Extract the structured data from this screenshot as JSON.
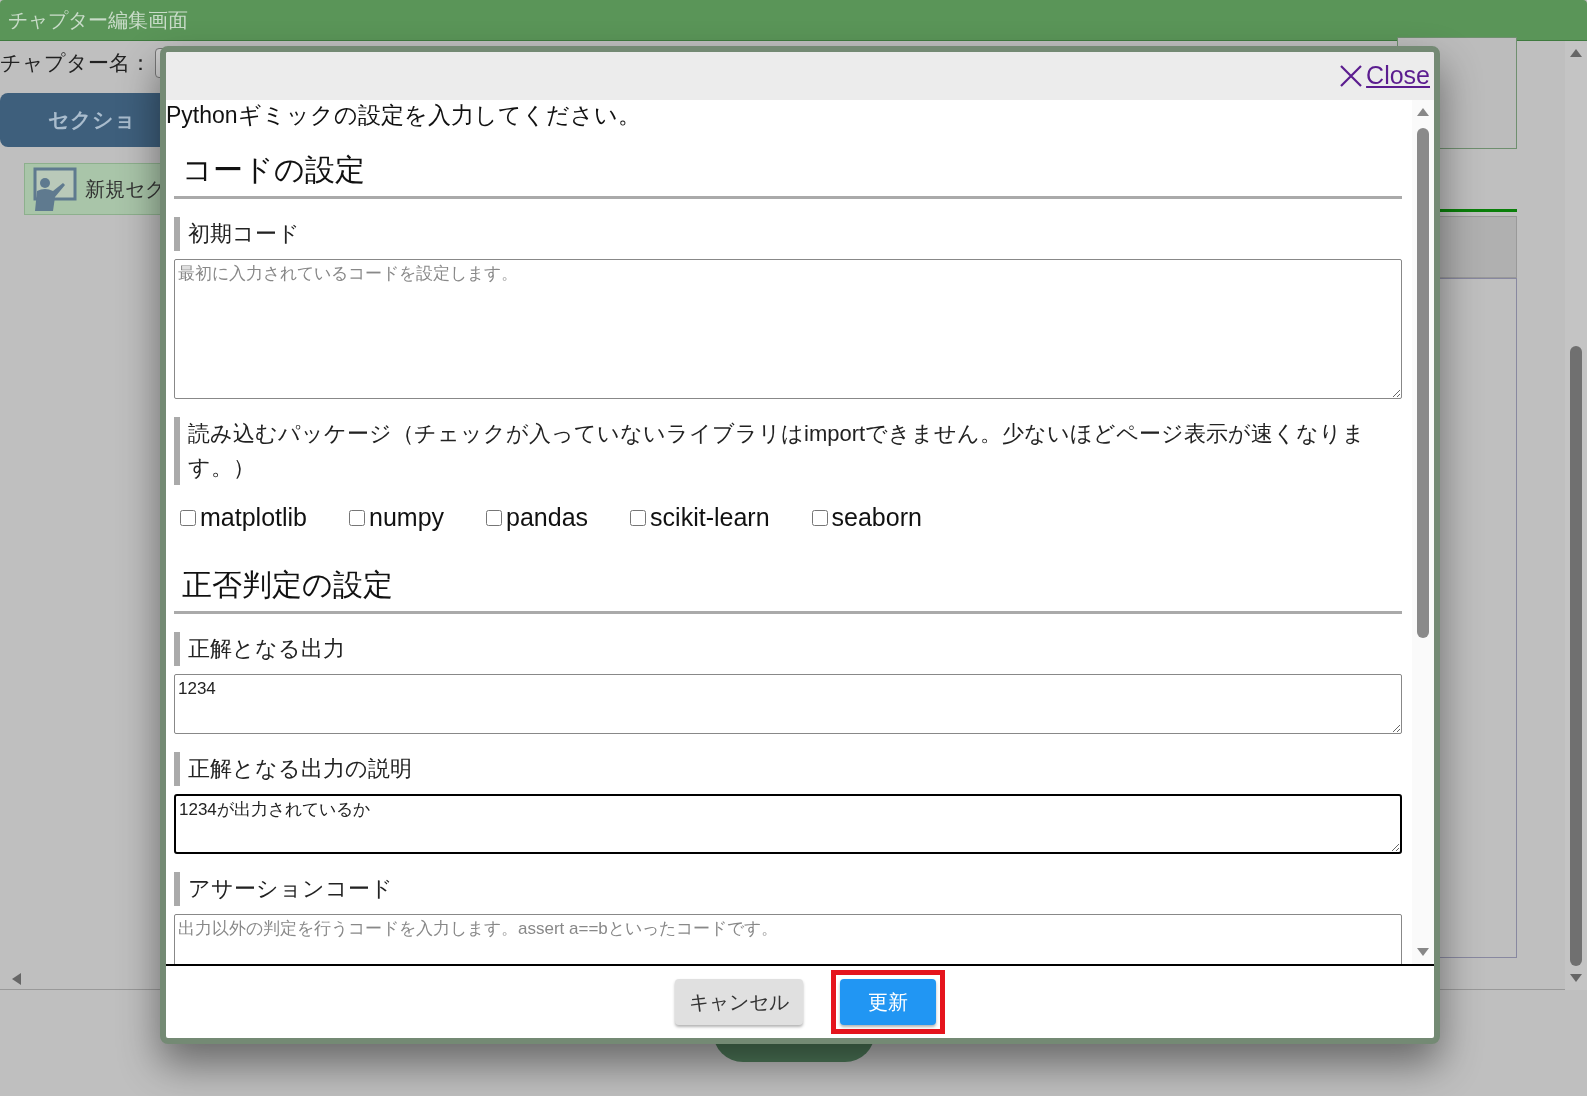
{
  "page": {
    "title": "チャプター編集画面",
    "chapter_name_label": "チャプター名：",
    "section_button": "セクショ",
    "section_item": "新規セク"
  },
  "dialog": {
    "close_label": "Close",
    "intro": "Pythonギミックの設定を入力してください。",
    "sections": [
      {
        "heading": "コードの設定",
        "items": [
          {
            "kind": "code",
            "label": "初期コード",
            "placeholder": "最初に入力されているコードを設定します。",
            "focused": false
          },
          {
            "kind": "checkboxes",
            "label": "読み込むパッケージ（チェックが入っていないライブラリはimportできません。少ないほどページ表示が速くなります。）",
            "options": [
              {
                "label": "matplotlib",
                "checked": false
              },
              {
                "label": "numpy",
                "checked": false
              },
              {
                "label": "pandas",
                "checked": false
              },
              {
                "label": "scikit-learn",
                "checked": false
              },
              {
                "label": "seaborn",
                "checked": false
              }
            ]
          }
        ]
      },
      {
        "heading": "正否判定の設定",
        "items": [
          {
            "kind": "line",
            "label": "正解となる出力",
            "value": "1234",
            "focused": false
          },
          {
            "kind": "line",
            "label": "正解となる出力の説明",
            "value": "1234が出力されているか",
            "focused": true
          },
          {
            "kind": "code",
            "label": "アサーションコード",
            "placeholder": "出力以外の判定を行うコードを入力します。assert a==bといったコードです。",
            "focused": false
          }
        ]
      }
    ],
    "buttons": [
      {
        "label": "キャンセル",
        "kind": "secondary",
        "highlighted": false
      },
      {
        "label": "更新",
        "kind": "primary",
        "highlighted": true
      }
    ]
  }
}
